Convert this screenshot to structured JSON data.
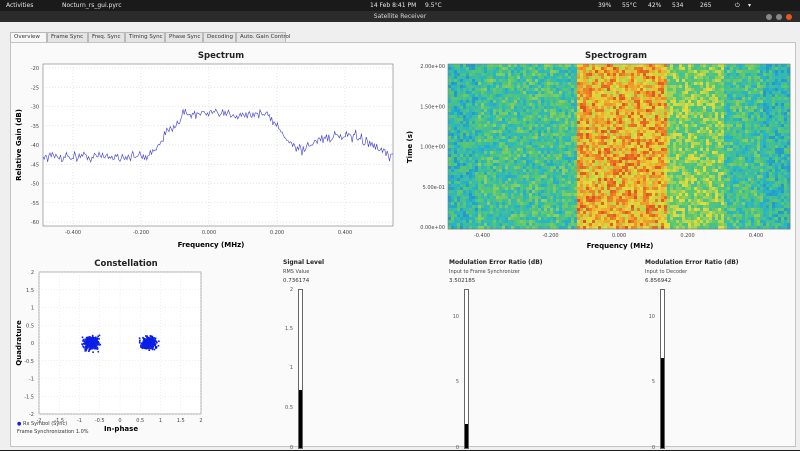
{
  "topbar": {
    "activities": "Activities",
    "app_name": "Nocturn_rs_gui.pyrc",
    "datetime": "14 Feb  8:41 PM",
    "weather": "9.5°C",
    "indicators": [
      "39%",
      "55°C",
      "42%",
      "534",
      "265"
    ]
  },
  "window": {
    "title": "Satellite Receiver"
  },
  "tabs": [
    "Overview",
    "Frame Sync",
    "Freq. Sync",
    "Timing Sync",
    "Phase Sync",
    "Decoding",
    "Auto. Gain Control"
  ],
  "spectrum": {
    "title": "Spectrum",
    "ylabel": "Relative Gain (dB)",
    "xlabel": "Frequency (MHz)",
    "yticks": [
      "-20",
      "-25",
      "-30",
      "-35",
      "-40",
      "-45",
      "-50",
      "-55",
      "-60"
    ],
    "xticks": [
      "-0.400",
      "-0.200",
      "0.000",
      "0.200",
      "0.400"
    ]
  },
  "spectrogram": {
    "title": "Spectrogram",
    "ylabel": "Time (s)",
    "xlabel": "Frequency (MHz)",
    "yticks": [
      "2.00e+00",
      "1.50e+00",
      "1.00e+00",
      "5.00e-01",
      "0.00e+00"
    ],
    "xticks": [
      "-0.400",
      "-0.200",
      "0.000",
      "0.200",
      "0.400"
    ]
  },
  "constellation": {
    "title": "Constellation",
    "xlabel": "In-phase",
    "ylabel": "Quadrature",
    "yticks": [
      "2",
      "1.5",
      "1",
      "0.5",
      "0",
      "-0.5",
      "-1",
      "-1.5",
      "-2"
    ],
    "xticks": [
      "-2",
      "-1.5",
      "-1",
      "-0.5",
      "0",
      "0.5",
      "1",
      "1.5",
      "2"
    ],
    "legend": [
      "Rx Symbol (Sync)",
      "Frame Synchronization",
      "1.0%"
    ]
  },
  "gauges": [
    {
      "title": "Signal Level",
      "sub": "RMS Value",
      "value": "0.736174",
      "ticks": [
        "2",
        "1.5",
        "1",
        "0.5",
        "0"
      ],
      "level": 0.37
    },
    {
      "title": "Modulation Error Ratio (dB)",
      "sub": "Input to Frame Synchronizer",
      "value": "3.502185",
      "ticks": [
        "10",
        "5",
        "0"
      ],
      "level": 0.15
    },
    {
      "title": "Modulation Error Ratio (dB)",
      "sub": "Input to Decoder",
      "value": "6.856942",
      "ticks": [
        "10",
        "5",
        "0"
      ],
      "level": 0.57
    }
  ],
  "colors": {
    "trace": "#3b3bd6",
    "constellation": "#0a1ee6",
    "gauge_fill": "#000000"
  }
}
